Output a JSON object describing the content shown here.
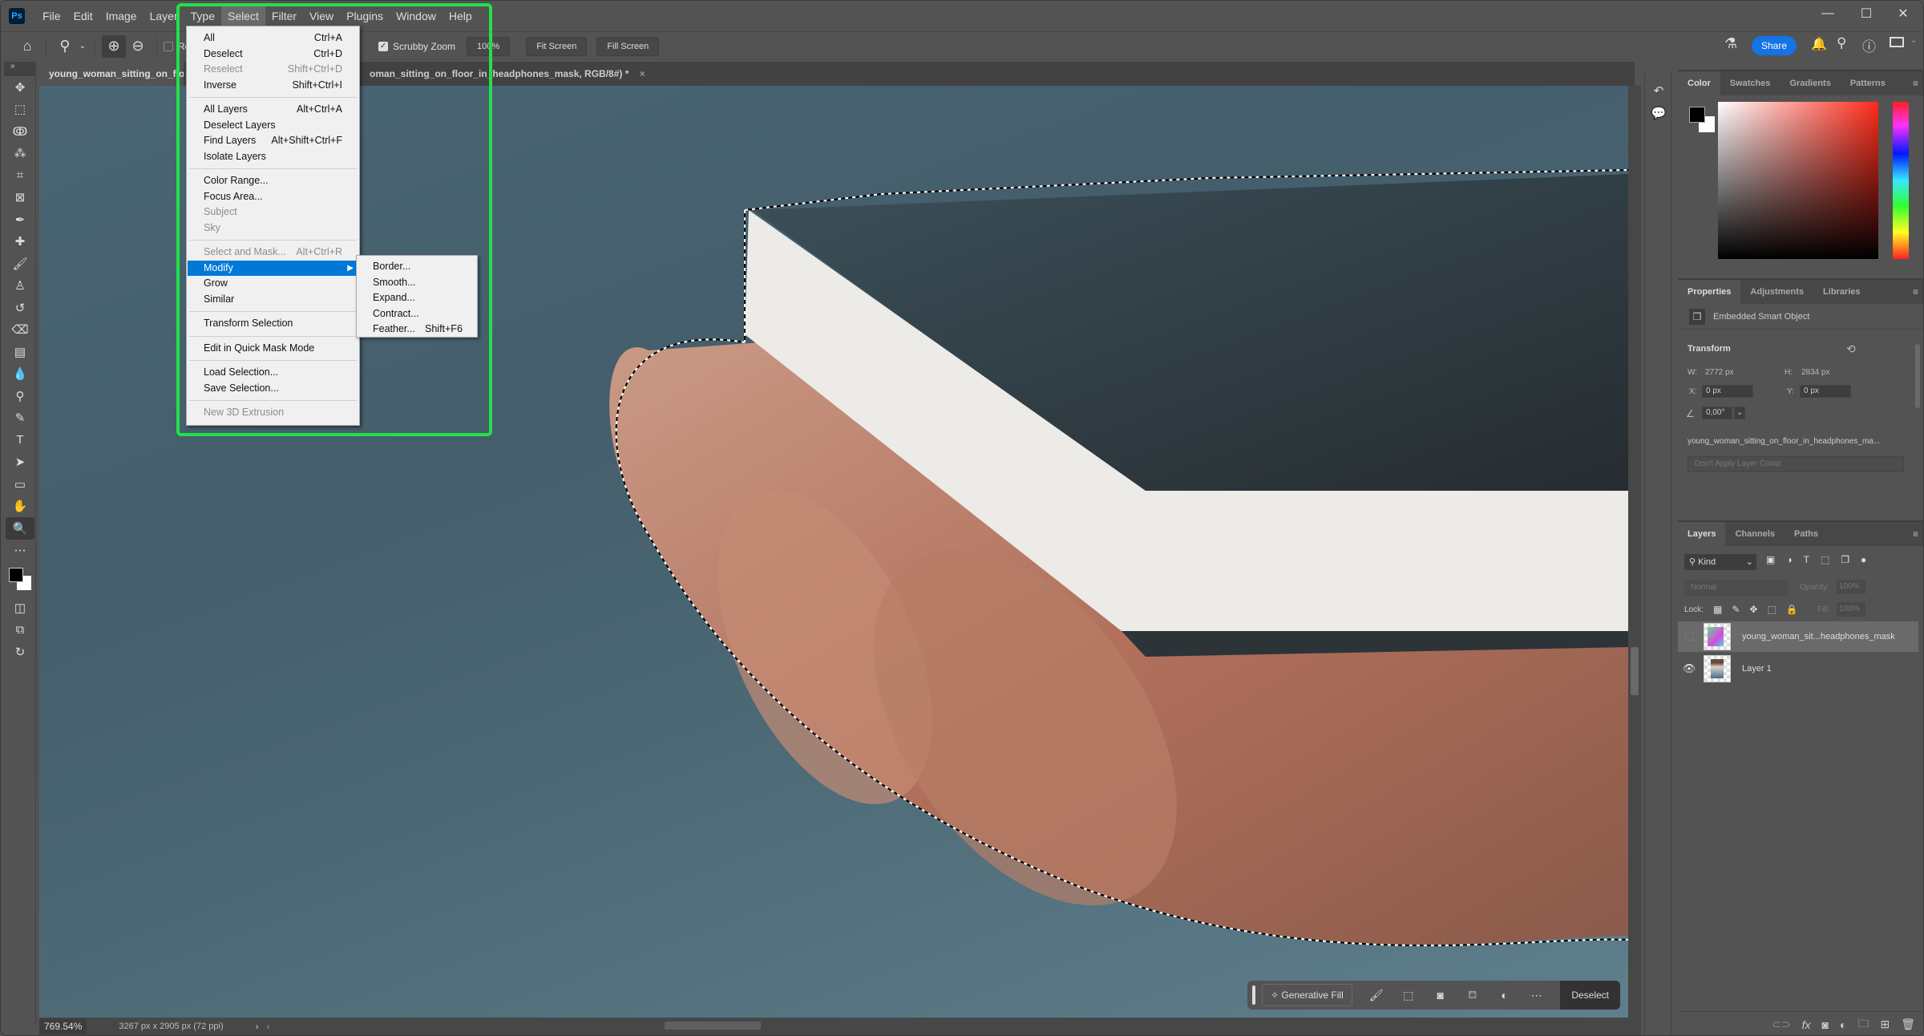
{
  "app": {
    "name": "Photoshop",
    "logo_text": "Ps"
  },
  "menubar": {
    "items": [
      "File",
      "Edit",
      "Image",
      "Layer",
      "Type",
      "Select",
      "Filter",
      "View",
      "Plugins",
      "Window",
      "Help"
    ],
    "active": "Select"
  },
  "window_controls": {
    "minimize": "—",
    "maximize": "☐",
    "close": "✕"
  },
  "options_bar": {
    "resize_label": "Resi",
    "scrubby_zoom_label": "Scrubby Zoom",
    "scrubby_zoom_checked": true,
    "zoom_value": "100%",
    "fit_screen": "Fit Screen",
    "fill_screen": "Fill Screen",
    "share": "Share"
  },
  "tabs": [
    {
      "label": "young_woman_sitting_on_floor",
      "active": true
    },
    {
      "label": "oman_sitting_on_floor_in_headphones_mask, RGB/8#) *",
      "active": false,
      "close": "×"
    }
  ],
  "select_menu": {
    "items": [
      {
        "label": "All",
        "shortcut": "Ctrl+A",
        "disabled": false
      },
      {
        "label": "Deselect",
        "shortcut": "Ctrl+D",
        "disabled": false
      },
      {
        "label": "Reselect",
        "shortcut": "Shift+Ctrl+D",
        "disabled": true
      },
      {
        "label": "Inverse",
        "shortcut": "Shift+Ctrl+I",
        "disabled": false
      },
      {
        "label": "All Layers",
        "shortcut": "Alt+Ctrl+A",
        "disabled": false
      },
      {
        "label": "Deselect Layers",
        "shortcut": "",
        "disabled": false
      },
      {
        "label": "Find Layers",
        "shortcut": "Alt+Shift+Ctrl+F",
        "disabled": false
      },
      {
        "label": "Isolate Layers",
        "shortcut": "",
        "disabled": false
      },
      {
        "label": "Color Range...",
        "shortcut": "",
        "disabled": false
      },
      {
        "label": "Focus Area...",
        "shortcut": "",
        "disabled": false
      },
      {
        "label": "Subject",
        "shortcut": "",
        "disabled": true
      },
      {
        "label": "Sky",
        "shortcut": "",
        "disabled": true
      },
      {
        "label": "Select and Mask...",
        "shortcut": "Alt+Ctrl+R",
        "disabled": true
      },
      {
        "label": "Modify",
        "shortcut": "",
        "disabled": false,
        "highlighted": true,
        "submenu_arrow": "▶"
      },
      {
        "label": "Grow",
        "shortcut": "",
        "disabled": false
      },
      {
        "label": "Similar",
        "shortcut": "",
        "disabled": false
      },
      {
        "label": "Transform Selection",
        "shortcut": "",
        "disabled": false
      },
      {
        "label": "Edit in Quick Mask Mode",
        "shortcut": "",
        "disabled": false
      },
      {
        "label": "Load Selection...",
        "shortcut": "",
        "disabled": false
      },
      {
        "label": "Save Selection...",
        "shortcut": "",
        "disabled": false
      },
      {
        "label": "New 3D Extrusion",
        "shortcut": "",
        "disabled": true
      }
    ]
  },
  "modify_submenu": {
    "items": [
      {
        "label": "Border...",
        "shortcut": ""
      },
      {
        "label": "Smooth...",
        "shortcut": ""
      },
      {
        "label": "Expand...",
        "shortcut": ""
      },
      {
        "label": "Contract...",
        "shortcut": ""
      },
      {
        "label": "Feather...",
        "shortcut": "Shift+F6"
      }
    ]
  },
  "tools": [
    "move-icon",
    "marquee-icon",
    "lasso-icon",
    "magic-wand-icon",
    "crop-icon",
    "frame-icon",
    "eyedropper-icon",
    "healing-brush-icon",
    "brush-icon",
    "clone-stamp-icon",
    "history-brush-icon",
    "eraser-icon",
    "gradient-icon",
    "blur-icon",
    "dodge-icon",
    "pen-icon",
    "type-icon",
    "path-select-icon",
    "rectangle-icon",
    "hand-icon",
    "zoom-icon",
    "more-tools-icon"
  ],
  "tool_glyphs": [
    "✥",
    "⬚",
    "ↂ",
    "⁂",
    "⌗",
    "⊠",
    "✒",
    "✚",
    "🖌",
    "♙",
    "↺",
    "⌫",
    "▤",
    "💧",
    "⚲",
    "✎",
    "T",
    "➤",
    "▭",
    "✋",
    "🔍",
    "⋯"
  ],
  "selected_tool": "zoom-icon",
  "color_panel": {
    "tabs": [
      "Color",
      "Swatches",
      "Gradients",
      "Patterns"
    ],
    "active": "Color",
    "foreground": "#000000",
    "background": "#ffffff"
  },
  "properties_panel": {
    "tabs": [
      "Properties",
      "Adjustments",
      "Libraries"
    ],
    "active": "Properties",
    "object_type": "Embedded Smart Object",
    "section": "Transform",
    "w_label": "W:",
    "w_value": "2772 px",
    "h_label": "H:",
    "h_value": "2834 px",
    "x_label": "X:",
    "x_value": "0 px",
    "y_label": "Y:",
    "y_value": "0 px",
    "angle_value": "0,00°",
    "linked_file": "young_woman_sitting_on_floor_in_headphones_ma...",
    "layer_comp": "Don't Apply Layer Comp"
  },
  "layers_panel": {
    "tabs": [
      "Layers",
      "Channels",
      "Paths"
    ],
    "active": "Layers",
    "filter_kind": "Kind",
    "blend_mode": "Normal",
    "opacity_label": "Opacity:",
    "opacity_value": "100%",
    "lock_label": "Lock:",
    "fill_label": "Fill:",
    "fill_value": "100%",
    "layers": [
      {
        "name": "young_woman_sit...headphones_mask",
        "visible": false,
        "selected": true
      },
      {
        "name": "Layer 1",
        "visible": true,
        "selected": false
      }
    ]
  },
  "context_bar": {
    "generative_fill": "Generative Fill",
    "deselect": "Deselect"
  },
  "status_bar": {
    "zoom": "769.54%",
    "doc_size": "3267 px x 2905 px (72 ppi)"
  }
}
